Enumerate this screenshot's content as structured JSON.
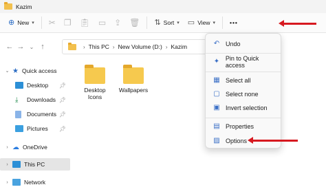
{
  "window": {
    "title": "Kazim"
  },
  "toolbar": {
    "new_label": "New",
    "sort_label": "Sort",
    "view_label": "View",
    "more_label": "•••"
  },
  "address": {
    "crumbs": [
      "This PC",
      "New Volume (D:)",
      "Kazim"
    ]
  },
  "sidebar": {
    "items": [
      {
        "label": "Quick access",
        "icon": "star-icon"
      },
      {
        "label": "Desktop",
        "icon": "desktop-icon"
      },
      {
        "label": "Downloads",
        "icon": "download-icon"
      },
      {
        "label": "Documents",
        "icon": "document-icon"
      },
      {
        "label": "Pictures",
        "icon": "picture-icon"
      },
      {
        "label": "OneDrive",
        "icon": "cloud-icon"
      },
      {
        "label": "This PC",
        "icon": "computer-icon"
      },
      {
        "label": "Network",
        "icon": "network-icon"
      }
    ]
  },
  "files": [
    {
      "name": "Desktop Icons"
    },
    {
      "name": "Wallpapers"
    }
  ],
  "menu": {
    "items": [
      {
        "label": "Undo",
        "icon": "undo-icon"
      },
      {
        "label": "Pin to Quick access",
        "icon": "pin-icon"
      },
      {
        "label": "Select all",
        "icon": "select-all-icon"
      },
      {
        "label": "Select none",
        "icon": "select-none-icon"
      },
      {
        "label": "Invert selection",
        "icon": "invert-selection-icon"
      },
      {
        "label": "Properties",
        "icon": "properties-icon"
      },
      {
        "label": "Options",
        "icon": "options-icon"
      }
    ]
  },
  "colors": {
    "accent": "#2b6cc4",
    "arrow": "#d71920",
    "folder": "#f6c94e",
    "selected": "#e5e5e5"
  }
}
